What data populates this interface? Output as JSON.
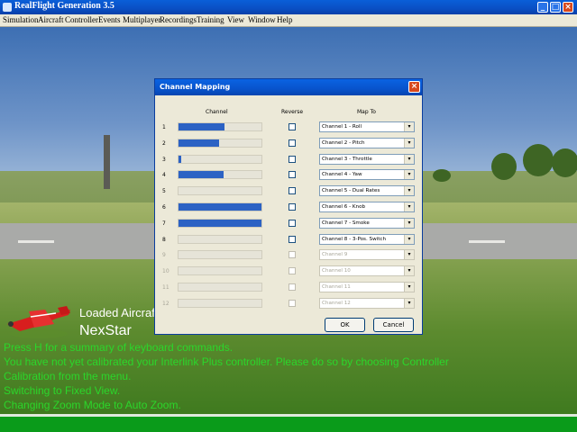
{
  "window": {
    "title": "RealFlight Generation 3.5",
    "minimize_glyph": "_",
    "maximize_glyph": "□",
    "close_glyph": "×"
  },
  "menu": [
    "Simulation",
    "Aircraft",
    "Controller",
    "Events",
    "Multiplayer",
    "Recordings",
    "Training",
    "View",
    "Window",
    "Help"
  ],
  "dialog": {
    "title": "Channel Mapping",
    "close_glyph": "×",
    "headers": {
      "channel": "Channel",
      "reverse": "Reverse",
      "map_to": "Map To"
    },
    "rows": [
      {
        "num": "1",
        "level": 0.55,
        "enabled": true,
        "map": "Channel 1 - Roll"
      },
      {
        "num": "2",
        "level": 0.49,
        "enabled": true,
        "map": "Channel 2 - Pitch"
      },
      {
        "num": "3",
        "level": 0.03,
        "enabled": true,
        "map": "Channel 3 - Throttle"
      },
      {
        "num": "4",
        "level": 0.54,
        "enabled": true,
        "map": "Channel 4 - Yaw"
      },
      {
        "num": "5",
        "level": 0.0,
        "enabled": true,
        "map": "Channel 5 - Dual Rates"
      },
      {
        "num": "6",
        "level": 1.0,
        "enabled": true,
        "map": "Channel 6 - Knob"
      },
      {
        "num": "7",
        "level": 1.0,
        "enabled": true,
        "map": "Channel 7 - Smoke"
      },
      {
        "num": "8",
        "level": 0.0,
        "enabled": true,
        "map": "Channel 8 - 3-Pos. Switch"
      },
      {
        "num": "9",
        "level": 0.0,
        "enabled": false,
        "map": "Channel 9"
      },
      {
        "num": "10",
        "level": 0.0,
        "enabled": false,
        "map": "Channel 10"
      },
      {
        "num": "11",
        "level": 0.0,
        "enabled": false,
        "map": "Channel 11"
      },
      {
        "num": "12",
        "level": 0.0,
        "enabled": false,
        "map": "Channel 12"
      }
    ],
    "ok_label": "OK",
    "cancel_label": "Cancel"
  },
  "overlay": {
    "loaded_label": "Loaded Aircraft",
    "aircraft_name": "NexStar",
    "messages": [
      "Press H for a summary of keyboard commands.",
      "You have not yet calibrated your Interlink Plus controller.  Please do so by choosing Controller",
      "Calibration from the menu.",
      "Switching to Fixed View.",
      "Changing Zoom Mode to Auto Zoom."
    ]
  },
  "colors": {
    "message_text": "#2bd62b",
    "channel_fill": "#2c62c4",
    "titlebar": "#0a5fd8"
  }
}
